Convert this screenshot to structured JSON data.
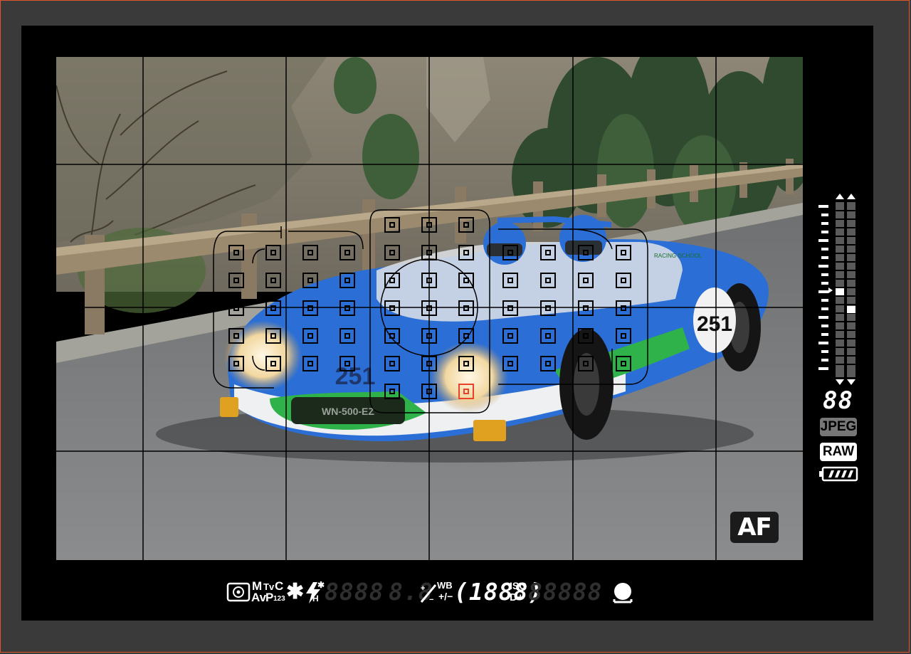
{
  "viewfinder": {
    "af_badge": "AF",
    "sidebar": {
      "shots_remaining": "88",
      "format_jpeg": "JPEG",
      "format_raw": "RAW",
      "battery_bars": 4
    },
    "bottom_bar": {
      "mode_top": "M",
      "mode_tv": "Tv",
      "mode_c": "C",
      "mode_av": "Av",
      "mode_p": "P",
      "mode_123": "123",
      "ae_lock": "✱",
      "flash_h": "H",
      "shutter_digits": "8888",
      "aperture_digits": "8.8",
      "exposure_scale": "(1888)",
      "wb_label": "WB",
      "pm_label": "+/−",
      "iso_label": "ISO",
      "dplus_label": "D+",
      "iso_digits": "88888"
    },
    "scene": {
      "car_number": "251",
      "plate": "WN-500-EZ",
      "sticker": "RACING SCHOOL"
    },
    "colors": {
      "active_af": "#e8432a",
      "car_blue": "#2b6fd6",
      "car_green": "#2fb24a"
    },
    "grid": {
      "columns": 5,
      "rows": 5
    },
    "af_points": {
      "total": 61,
      "active_index": 57
    }
  }
}
